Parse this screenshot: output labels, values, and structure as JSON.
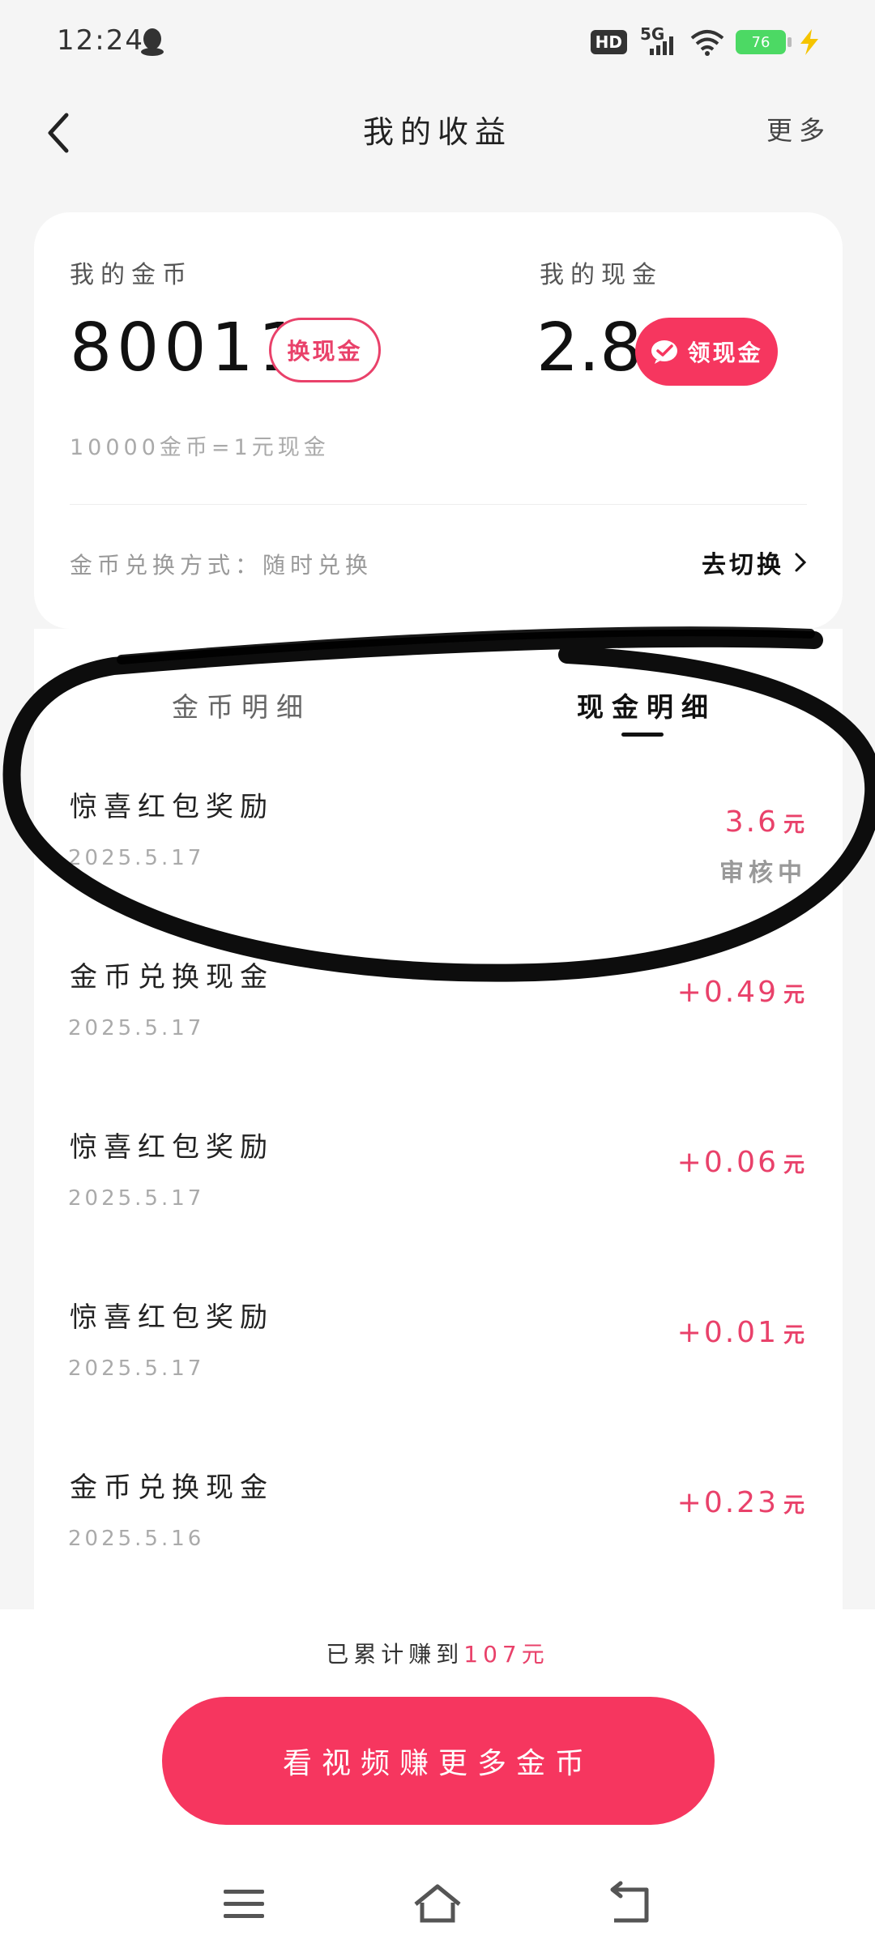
{
  "status_bar": {
    "time": "12:24",
    "network": "5G",
    "hd": "HD",
    "battery": "76"
  },
  "nav": {
    "title": "我的收益",
    "more": "更多"
  },
  "summary": {
    "coins_label": "我的金币",
    "coins_value": "80011",
    "exchange_button": "换现金",
    "cash_label": "我的现金",
    "cash_value": "2.8",
    "withdraw_button": "领现金",
    "rate": "10000金币=1元现金",
    "method": "金币兑换方式：随时兑换",
    "switch_link": "去切换"
  },
  "tabs": {
    "coins": "金币明细",
    "cash": "现金明细"
  },
  "records": [
    {
      "title": "惊喜红包奖励",
      "date": "2025.5.17",
      "amount": "3.6",
      "unit": "元",
      "status": "审核中"
    },
    {
      "title": "金币兑换现金",
      "date": "2025.5.17",
      "amount": "+0.49",
      "unit": "元",
      "status": ""
    },
    {
      "title": "惊喜红包奖励",
      "date": "2025.5.17",
      "amount": "+0.06",
      "unit": "元",
      "status": ""
    },
    {
      "title": "惊喜红包奖励",
      "date": "2025.5.17",
      "amount": "+0.01",
      "unit": "元",
      "status": ""
    },
    {
      "title": "金币兑换现金",
      "date": "2025.5.16",
      "amount": "+0.23",
      "unit": "元",
      "status": ""
    }
  ],
  "bottom": {
    "earned_prefix": "已累计赚到",
    "earned_amount": "107元",
    "cta": "看视频赚更多金币"
  },
  "colors": {
    "accent": "#f6365f",
    "amount": "#e9416a"
  }
}
